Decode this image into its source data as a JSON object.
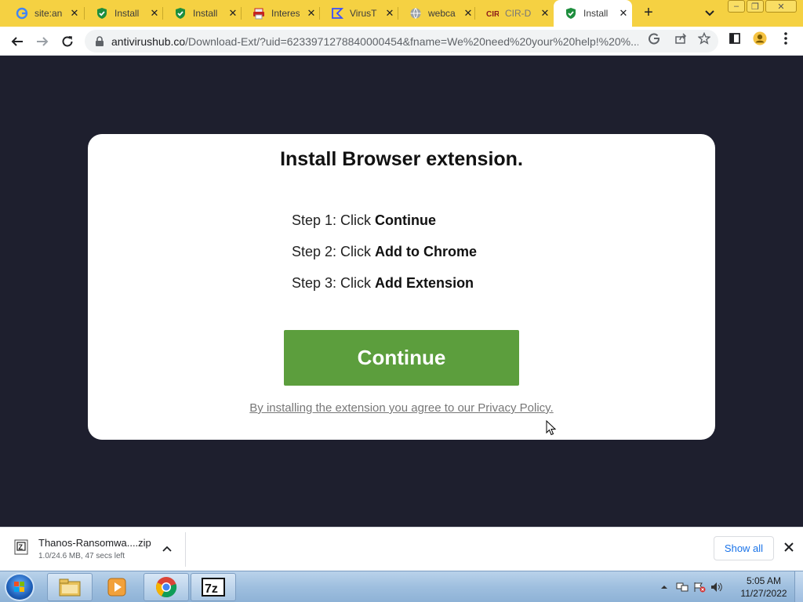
{
  "tabs": [
    {
      "title": "site:an",
      "favicon": "google-icon",
      "active": false
    },
    {
      "title": "Install",
      "favicon": "shield-check-icon",
      "active": false
    },
    {
      "title": "Install",
      "favicon": "shield-check-icon",
      "active": false
    },
    {
      "title": "Interes",
      "favicon": "printer-icon",
      "active": false
    },
    {
      "title": "VirusT",
      "favicon": "virustotal-icon",
      "active": false
    },
    {
      "title": "webca",
      "favicon": "globe-icon",
      "active": false
    },
    {
      "title": "CIR-D",
      "favicon": "cir-icon",
      "active": false
    },
    {
      "title": "Install",
      "favicon": "shield-check-icon",
      "active": true
    }
  ],
  "toolbar": {
    "url_host": "antivirushub.co",
    "url_path": "/Download-Ext/?uid=6233971278840000454&fname=We%20need%20your%20help!%20%..."
  },
  "page": {
    "heading": "Install Browser extension.",
    "steps": [
      {
        "prefix": "Step 1: Click ",
        "action": "Continue"
      },
      {
        "prefix": "Step 2: Click ",
        "action": "Add to Chrome"
      },
      {
        "prefix": "Step 3: Click ",
        "action": "Add Extension"
      }
    ],
    "continue_label": "Continue",
    "privacy_text": "By installing the extension you agree to our Privacy Policy."
  },
  "download": {
    "file_name": "Thanos-Ransomwa....zip",
    "status": "1.0/24.6 MB, 47 secs left",
    "show_all_label": "Show all"
  },
  "taskbar": {
    "time": "5:05 AM",
    "date": "11/27/2022"
  },
  "colors": {
    "tabstrip": "#f5d142",
    "page_background": "#1e1f2e",
    "continue_button": "#5c9e3d"
  }
}
